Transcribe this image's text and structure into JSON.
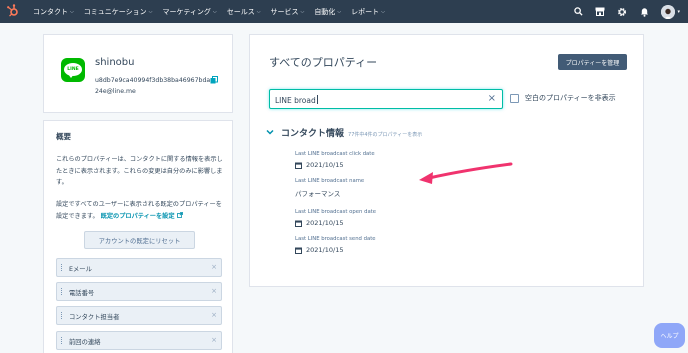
{
  "nav": {
    "menu": [
      "コンタクト",
      "コミュニケーション",
      "マーケティング",
      "セールス",
      "サービス",
      "自動化",
      "レポート"
    ],
    "icons": [
      "search-icon",
      "marketplace-icon",
      "settings-icon",
      "notifications-icon"
    ],
    "colors": {
      "bar": "#2d3e50",
      "logo": "#ff7a59"
    }
  },
  "profile": {
    "name": "shinobu",
    "id": "u8db7e9ca40994f3db38ba46967bda24e@line.me"
  },
  "about": {
    "title": "概要",
    "desc1": "これらのプロパティーは、コンタクトに関する情報を表示したときに表示されます。これらの変更は自分のみに影響します。",
    "desc2_prefix": "設定ですべてのユーザーに表示される既定のプロパティーを設定できます。",
    "desc2_link": "既定のプロパティーを設定",
    "reset_button": "アカウントの既定にリセット",
    "items": [
      "Eメール",
      "電話番号",
      "コンタクト担当者",
      "前回の連絡"
    ]
  },
  "main": {
    "title": "すべてのプロパティー",
    "manage_button": "プロパティーを管理",
    "search_value": "LINE broad",
    "hide_empty_label": "空白のプロパティーを非表示",
    "section_title": "コンタクト情報",
    "section_count": "77件中4件のプロパティーを表示",
    "fields": [
      {
        "label": "Last LINE broadcast click date",
        "value": "2021/10/15",
        "is_date": true
      },
      {
        "label": "Last LINE broadcast name",
        "value": "パフォーマンス",
        "is_date": false
      },
      {
        "label": "Last LINE broadcast open date",
        "value": "2021/10/15",
        "is_date": true
      },
      {
        "label": "Last LINE broadcast send date",
        "value": "2021/10/15",
        "is_date": true
      }
    ]
  },
  "annotation": {
    "color": "#f0336e"
  },
  "help_button": "ヘルプ"
}
